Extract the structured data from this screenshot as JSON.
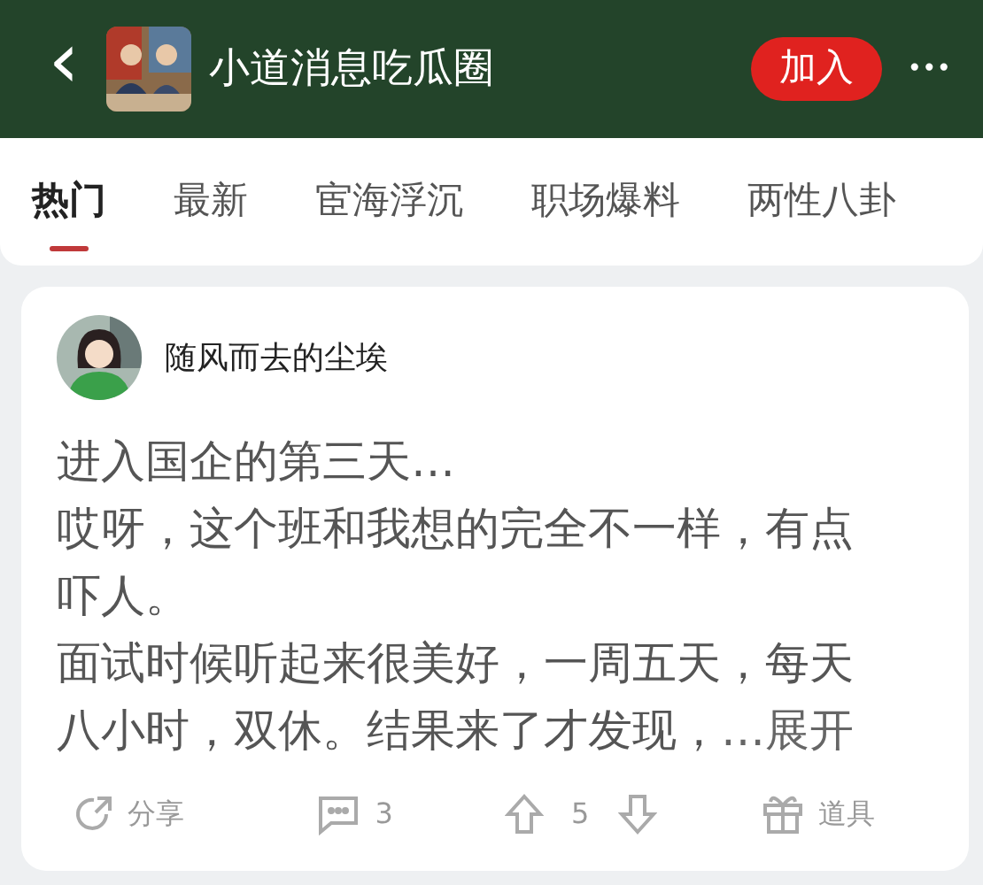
{
  "header": {
    "back_icon": "‹",
    "title": "小道消息吃瓜圈",
    "join_button": "加入",
    "more": "•••"
  },
  "tabs": [
    {
      "label": "热门",
      "selected": true
    },
    {
      "label": "最新",
      "selected": false
    },
    {
      "label": "宦海浮沉",
      "selected": false
    },
    {
      "label": "职场爆料",
      "selected": false
    },
    {
      "label": "两性八卦",
      "selected": false
    }
  ],
  "post": {
    "author": "随风而去的尘埃",
    "paragraphs": [
      "进入国企的第三天…",
      "哎呀，这个班和我想的完全不一样，有点吓人。",
      "面试时候听起来很美好，一周五天，每天八小时，双休。结果来了才发现，"
    ],
    "expand_link": "…展开",
    "actions": [
      {
        "kind": "share",
        "label": "分享"
      },
      {
        "kind": "comment",
        "label": "3"
      },
      {
        "kind": "vote",
        "label": "5"
      },
      {
        "kind": "gift",
        "label": "道具"
      }
    ]
  }
}
